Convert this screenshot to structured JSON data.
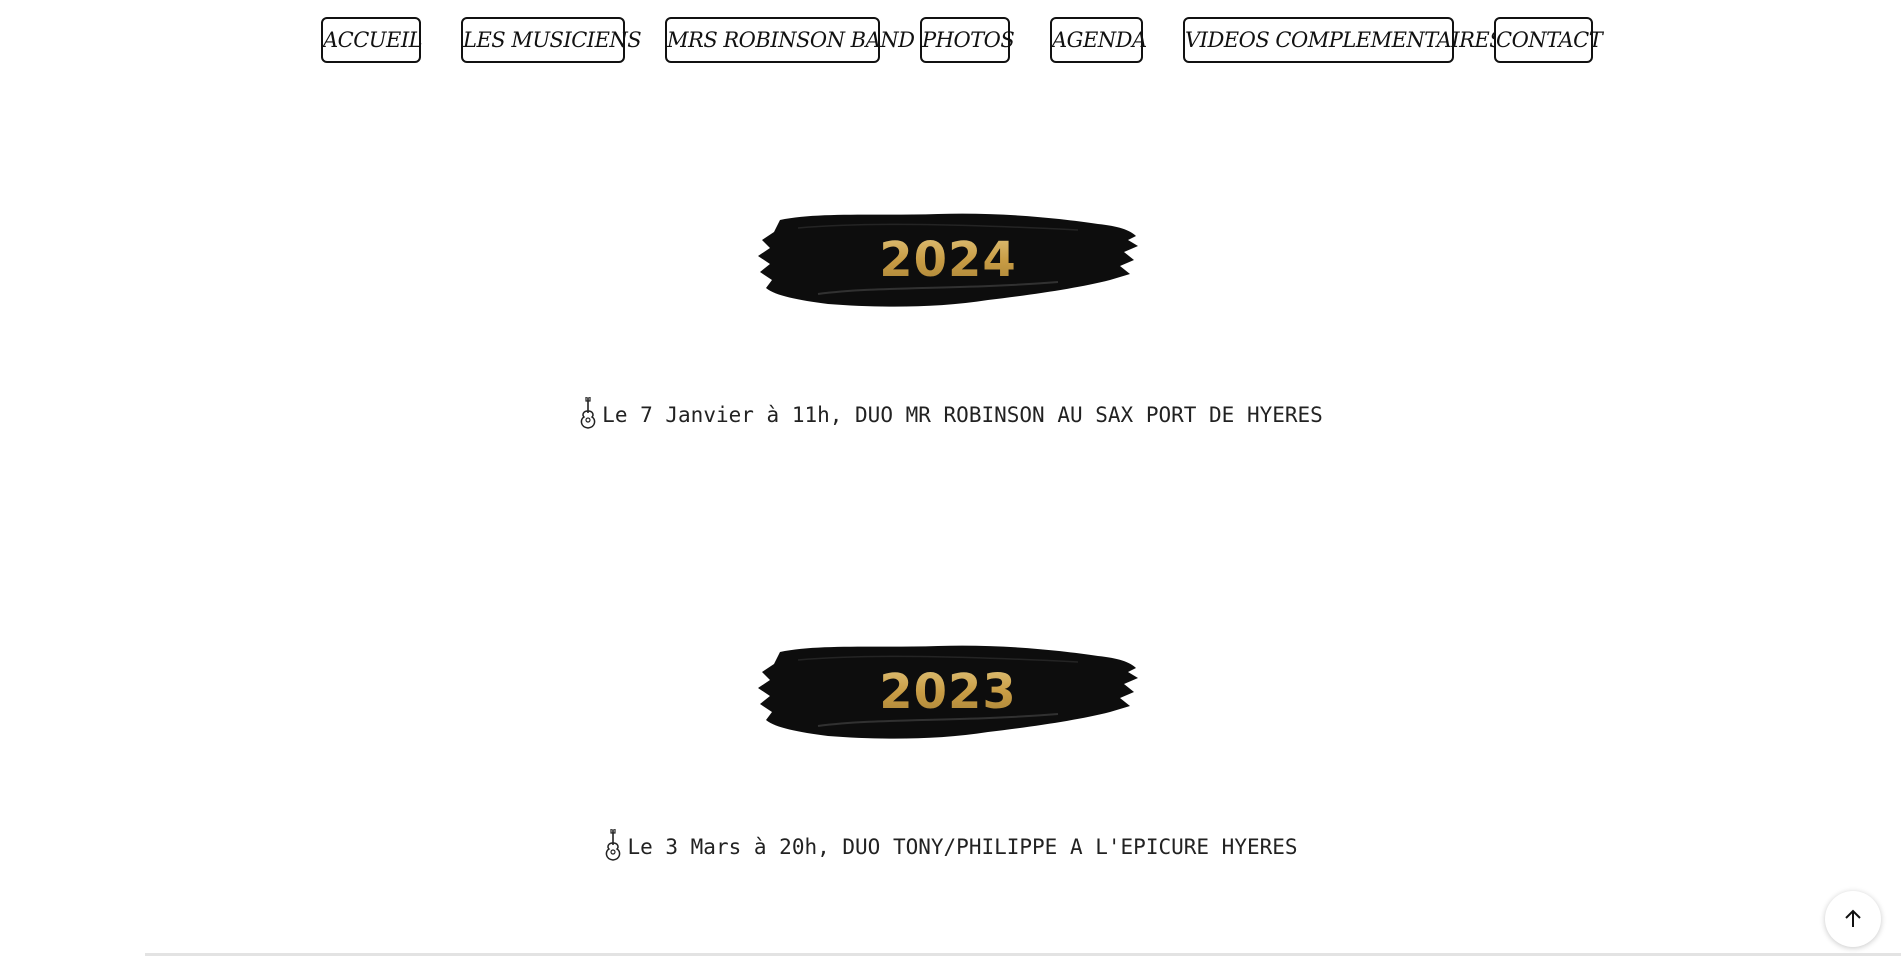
{
  "nav": {
    "items": [
      {
        "label": "ACCUEIL"
      },
      {
        "label": "LES MUSICIENS"
      },
      {
        "label": "MRS ROBINSON BAND"
      },
      {
        "label": "PHOTOS"
      },
      {
        "label": "AGENDA"
      },
      {
        "label": "VIDEOS COMPLEMENTAIRES"
      },
      {
        "label": "CONTACT"
      }
    ]
  },
  "agenda": {
    "years": [
      {
        "year": "2024",
        "events": [
          {
            "text": "Le 7 Janvier à 11h, DUO MR ROBINSON AU SAX PORT DE HYERES"
          }
        ]
      },
      {
        "year": "2023",
        "events": [
          {
            "text": "Le 3 Mars à 20h, DUO TONY/PHILIPPE A L'EPICURE HYERES"
          }
        ]
      }
    ]
  },
  "icons": {
    "event_icon": "guitar-icon",
    "scroll_top_icon": "arrow-up-icon"
  },
  "colors": {
    "year_gold": "#c99d45",
    "brush_black": "#0d0d0d"
  }
}
